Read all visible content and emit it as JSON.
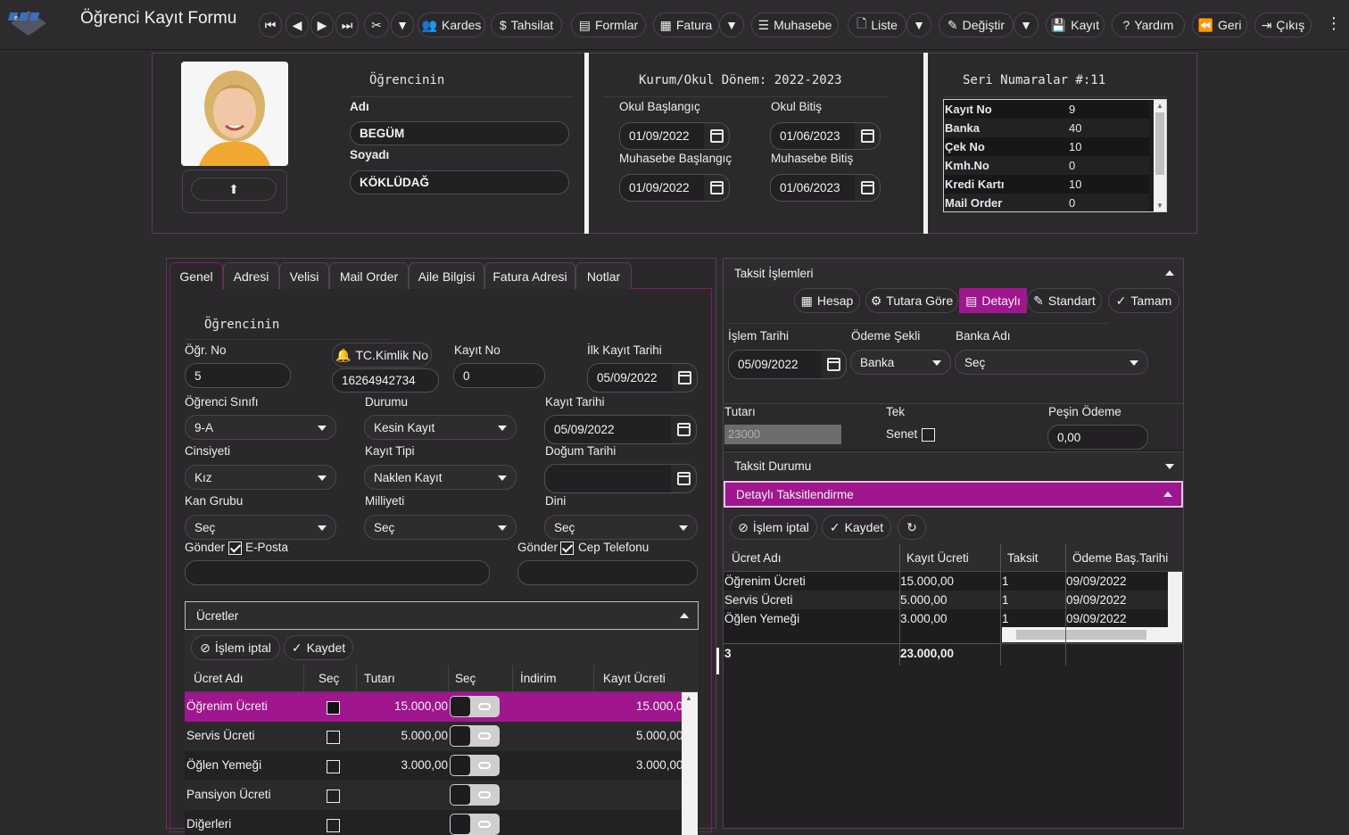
{
  "app": {
    "title": "Öğrenci Kayıt Formu"
  },
  "toolbar": {
    "kardes": "Kardes",
    "tahsilat": "Tahsilat",
    "formlar": "Formlar",
    "fatura": "Fatura",
    "muhasebe": "Muhasebe",
    "liste": "Liste",
    "degistir": "Değiştir",
    "kayit": "Kayıt",
    "yardim": "Yardım",
    "geri": "Geri",
    "cikis": "Çıkış"
  },
  "student": {
    "section_title": "Öğrencinin",
    "name_label": "Adı",
    "name": "BEGÜM",
    "surname_label": "Soyadı",
    "surname": "KÖKLÜDAĞ"
  },
  "period": {
    "title": "Kurum/Okul Dönem: 2022-2023",
    "school_start_label": "Okul Başlangıç",
    "school_start": "01/09/2022",
    "school_end_label": "Okul Bitiş",
    "school_end": "01/06/2023",
    "acc_start_label": "Muhasebe Başlangıç",
    "acc_start": "01/09/2022",
    "acc_end_label": "Muhasebe Bitiş",
    "acc_end": "01/06/2023"
  },
  "serials": {
    "title": "Seri Numaralar #:11",
    "rows": [
      {
        "name": "Kayıt No",
        "value": "9"
      },
      {
        "name": "Banka",
        "value": "40"
      },
      {
        "name": "Çek No",
        "value": "10"
      },
      {
        "name": "Kmh.No",
        "value": "0"
      },
      {
        "name": "Kredi Kartı",
        "value": "10"
      },
      {
        "name": "Mail Order",
        "value": "0"
      }
    ]
  },
  "tabs": [
    "Genel",
    "Adresi",
    "Velisi",
    "Mail Order",
    "Aile Bilgisi",
    "Fatura Adresi",
    "Notlar"
  ],
  "general": {
    "section_title": "Öğrencinin",
    "ogr_no_label": "Öğr. No",
    "ogr_no": "5",
    "tc_button": "TC.Kimlik No",
    "tc_no": "16264942734",
    "kayit_no_label": "Kayıt No",
    "kayit_no": "0",
    "ilk_kayit_label": "İlk Kayıt Tarihi",
    "ilk_kayit": "05/09/2022",
    "sinif_label": "Öğrenci Sınıfı",
    "sinif": "9-A",
    "durum_label": "Durumu",
    "durum": "Kesin Kayıt",
    "kayit_tarihi_label": "Kayıt Tarihi",
    "kayit_tarihi": "05/09/2022",
    "cinsiyet_label": "Cinsiyeti",
    "cinsiyet": "Kız",
    "kayit_tipi_label": "Kayıt Tipi",
    "kayit_tipi": "Naklen Kayıt",
    "dogum_label": "Doğum Tarihi",
    "dogum": "",
    "kan_label": "Kan Grubu",
    "kan": "Seç",
    "milliyet_label": "Milliyeti",
    "milliyet": "Seç",
    "din_label": "Dini",
    "din": "Seç",
    "gonder_label": "Gönder",
    "eposta_label": "E-Posta",
    "cep_label": "Cep Telefonu"
  },
  "fees": {
    "title": "Ücretler",
    "cancel": "İşlem iptal",
    "save": "Kaydet",
    "headers": [
      "Ücret Adı",
      "Seç",
      "Tutarı",
      "Seç",
      "İndirim",
      "Kayıt Ücreti"
    ],
    "rows": [
      {
        "name": "Öğrenim Ücreti",
        "amount": "15.000,00",
        "fee": "15.000,00"
      },
      {
        "name": "Servis Ücreti",
        "amount": "5.000,00",
        "fee": "5.000,00"
      },
      {
        "name": "Öğlen Yemeği",
        "amount": "3.000,00",
        "fee": "3.000,00"
      },
      {
        "name": "Pansiyon Ücreti",
        "amount": "",
        "fee": ""
      },
      {
        "name": "Diğerleri",
        "amount": "",
        "fee": ""
      }
    ]
  },
  "installment": {
    "title": "Taksit İşlemleri",
    "btn_hesap": "Hesap",
    "btn_tutara": "Tutara Göre",
    "btn_detayli": "Detaylı",
    "btn_standart": "Standart",
    "btn_tamam": "Tamam",
    "islem_tarihi_label": "İşlem Tarihi",
    "islem_tarihi": "05/09/2022",
    "odeme_sekli_label": "Ödeme Şekli",
    "odeme_sekli": "Banka",
    "banka_label": "Banka Adı",
    "banka": "Seç",
    "tutar_label": "Tutarı",
    "tutar": "23000",
    "tek_label": "Tek",
    "senet_label": "Senet",
    "pesin_label": "Peşin Ödeme",
    "pesin": "0,00",
    "durum_title": "Taksit Durumu",
    "detay_title": "Detaylı Taksitlendirme",
    "cancel": "İşlem iptal",
    "save": "Kaydet",
    "headers": [
      "Ücret Adı",
      "Kayıt Ücreti",
      "Taksit",
      "Ödeme Baş.Tarihi"
    ],
    "rows": [
      {
        "name": "Öğrenim Ücreti",
        "fee": "15.000,00",
        "count": "1",
        "date": "09/09/2022"
      },
      {
        "name": "Servis Ücreti",
        "fee": "5.000,00",
        "count": "1",
        "date": "09/09/2022"
      },
      {
        "name": "Öğlen Yemeği",
        "fee": "3.000,00",
        "count": "1",
        "date": "09/09/2022"
      }
    ],
    "footer_count": "3",
    "footer_total": "23.000,00"
  },
  "colors": {
    "accent": "#a0168f",
    "background": "#2d2a2e"
  }
}
